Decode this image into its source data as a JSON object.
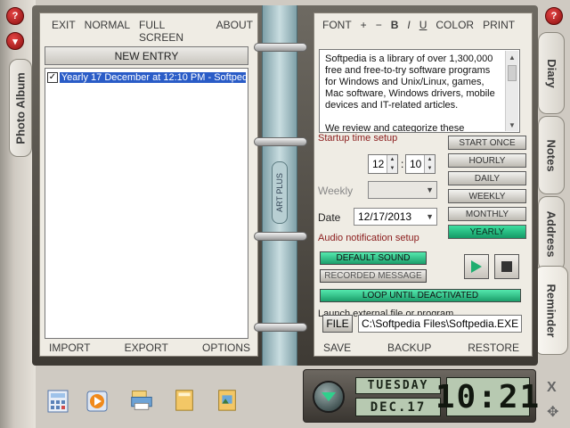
{
  "window": {
    "colors": {
      "accent_green": "#2fd08c",
      "close_red": "#c81e1e",
      "selection": "#2a5cc7"
    }
  },
  "left_tabs": {
    "photo_album": "Photo Album"
  },
  "right_tabs": [
    "Diary",
    "Notes",
    "Address",
    "Reminder"
  ],
  "top_controls": {
    "close": "?",
    "minimize": "▾"
  },
  "left_page": {
    "menu": [
      "EXIT",
      "NORMAL",
      "FULL SCREEN",
      "ABOUT"
    ],
    "new_entry": "NEW ENTRY",
    "entries": [
      {
        "checked": true,
        "text": "Yearly 17 December at 12:10 PM - Softped"
      }
    ],
    "bottom_menu": [
      "IMPORT",
      "EXPORT",
      "OPTIONS"
    ]
  },
  "spine": {
    "label": "ART PLUS"
  },
  "right_page": {
    "menu": [
      "FONT",
      "+",
      "−",
      "B",
      "I",
      "U",
      "COLOR",
      "PRINT"
    ],
    "text": "Softpedia is a library of over 1,300,000 free and free-to-try software programs for Windows and Unix/Linux, games, Mac software, Windows drivers, mobile devices and IT-related articles.",
    "text_more": "We review and categorize these",
    "startup_label": "Startup time setup",
    "schedule_buttons": [
      "START ONCE",
      "HOURLY",
      "DAILY",
      "WEEKLY",
      "MONTHLY",
      "YEARLY"
    ],
    "active_schedule": "YEARLY",
    "hour": "12",
    "minute": "10",
    "weekly_label": "Weekly",
    "weekly_value": "",
    "date_label": "Date",
    "date_value": "12/17/2013",
    "audio_label": "Audio notification setup",
    "default_sound": "DEFAULT SOUND",
    "recorded_message": "RECORDED MESSAGE",
    "loop": "LOOP  UNTIL  DEACTIVATED",
    "launch_label": "Launch external file or program",
    "file_button": "FILE",
    "file_path": "C:\\Softpedia Files\\Softpedia.EXE",
    "bottom_menu": [
      "SAVE",
      "BACKUP",
      "RESTORE"
    ]
  },
  "dock_icons": [
    "calculator-icon",
    "media-player-icon",
    "printer-icon",
    "folder-icon",
    "photo-folder-icon"
  ],
  "clock": {
    "day": "TUESDAY",
    "date": "DEC.17",
    "time": "10:21"
  },
  "corner": {
    "close": "X",
    "move": "✥"
  }
}
